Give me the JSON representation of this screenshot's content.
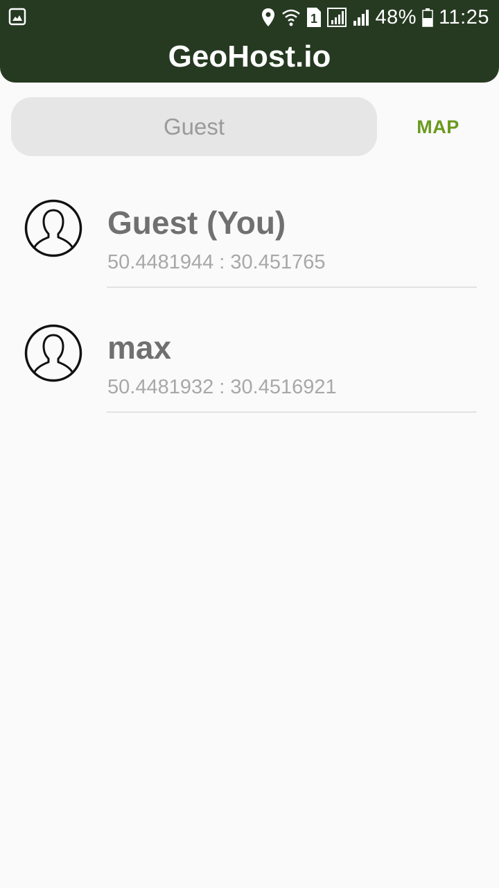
{
  "status_bar": {
    "battery_percent": "48%",
    "time": "11:25",
    "sim_slot": "1",
    "icons": [
      "gallery-notification-icon",
      "location-icon",
      "wifi-icon",
      "sim-icon",
      "signal-icon",
      "signal-icon",
      "battery-icon"
    ]
  },
  "app": {
    "title": "GeoHost.io"
  },
  "name_field": {
    "value": "",
    "placeholder": "Guest"
  },
  "map_button": {
    "label": "MAP"
  },
  "users": [
    {
      "name": "Guest (You)",
      "coords": "50.4481944 : 30.451765",
      "icon": "user-avatar-icon"
    },
    {
      "name": "max",
      "coords": "50.4481932 : 30.4516921",
      "icon": "user-avatar-icon"
    }
  ],
  "colors": {
    "app_bar": "#263a22",
    "accent": "#6a9a1e",
    "background": "#fafafa"
  }
}
